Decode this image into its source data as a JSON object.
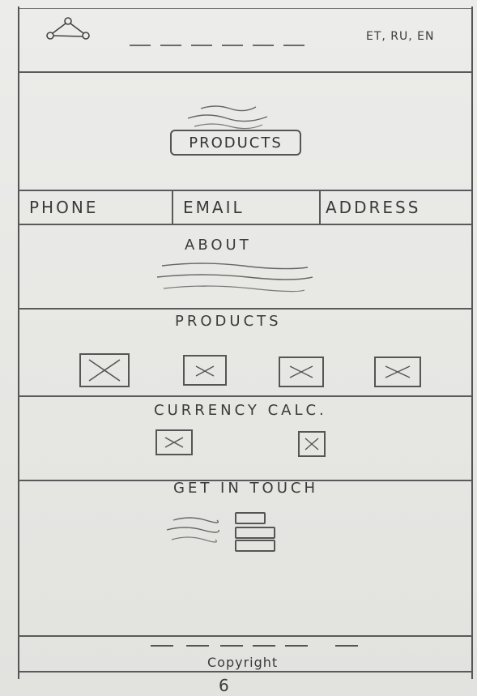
{
  "header": {
    "logo_icon": "logo-icon",
    "nav_icon": "nav-links-placeholder-icon",
    "languages": "ET, RU, EN"
  },
  "hero": {
    "text_icon": "squiggle-text-icon",
    "button_label": "PRODUCTS"
  },
  "contact": {
    "phone": "PHONE",
    "email": "EMAIL",
    "address": "ADDRESS"
  },
  "about": {
    "title": "ABOUT",
    "text_icon": "squiggle-text-icon"
  },
  "products": {
    "title": "PRODUCTS",
    "image_icon": "image-placeholder-icon"
  },
  "currency": {
    "title": "CURRENCY CALC.",
    "image_icon": "image-placeholder-icon"
  },
  "contact_form": {
    "title": "GET IN TOUCH",
    "text_icon": "squiggle-text-icon",
    "form_icon": "form-fields-icon"
  },
  "footer": {
    "copyright": "Copyright",
    "page_number": "6"
  },
  "colors": {
    "paper": "#e9e9e6",
    "ink": "#3a3a3a"
  }
}
